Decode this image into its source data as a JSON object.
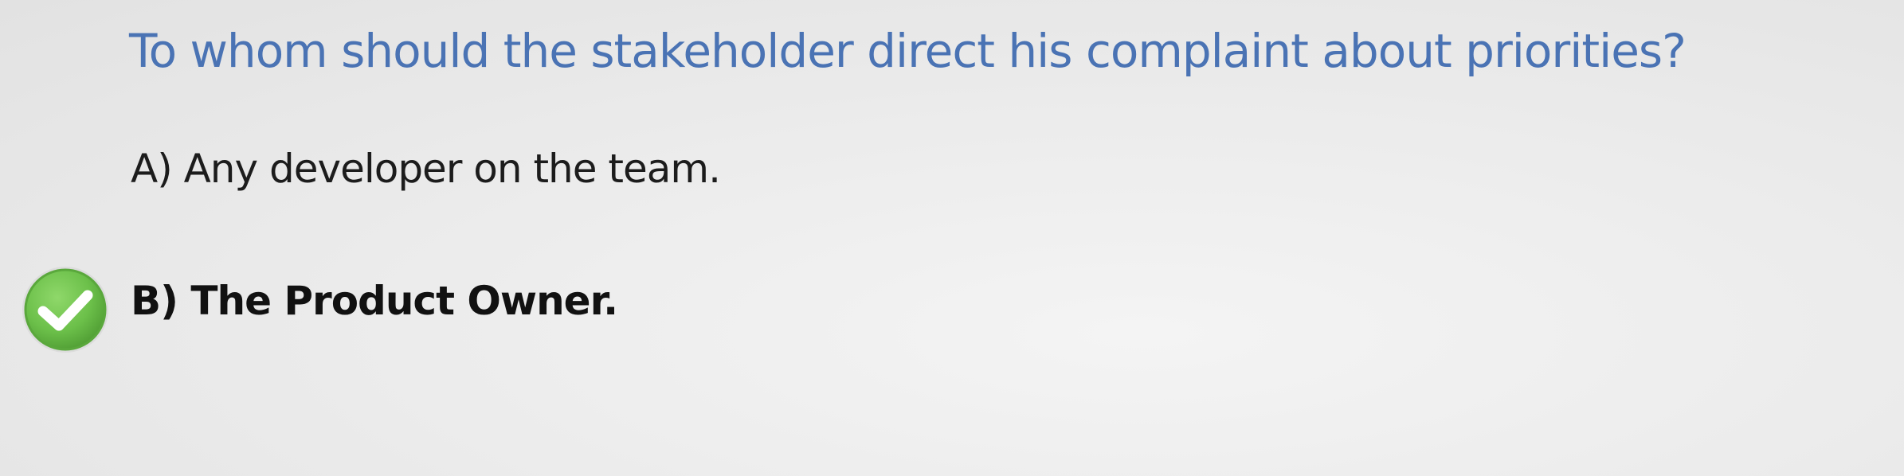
{
  "question": {
    "text": "To whom should the stakeholder direct his complaint about priorities?"
  },
  "options": [
    {
      "label": "A) Any developer on the team.",
      "correct": false
    },
    {
      "label": "B) The Product Owner.",
      "correct": true
    }
  ],
  "colors": {
    "question": "#4a73b4",
    "answer_text": "#1c1c1c",
    "check_green": "#6cc04a",
    "check_ring": "#5aa83c"
  },
  "icons": {
    "correct_marker": "checkmark-circle-icon"
  }
}
